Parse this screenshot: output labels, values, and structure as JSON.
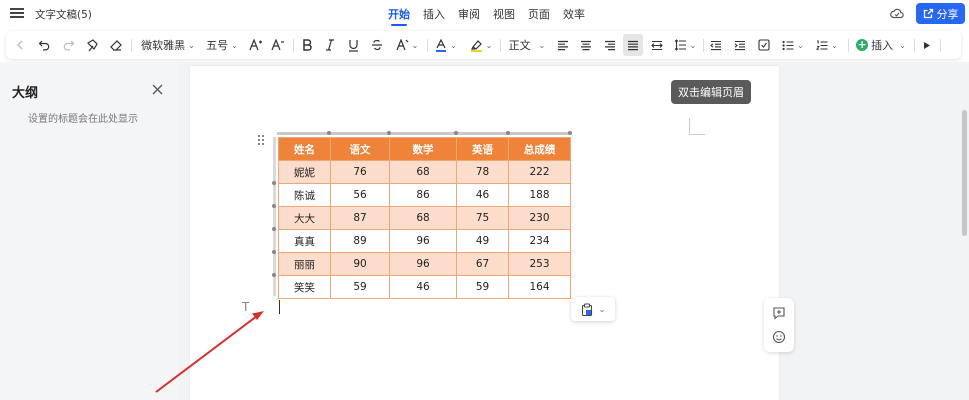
{
  "app": {
    "doc_title": "文字文稿(5)",
    "menu_tabs": [
      "开始",
      "插入",
      "审阅",
      "视图",
      "页面",
      "效率"
    ],
    "active_tab": "开始",
    "share_label": "分享",
    "accent_color": "#2866f6"
  },
  "toolbar": {
    "font_name": "微软雅黑",
    "font_size": "五号",
    "style_name": "正文",
    "insert_label": "插入",
    "icons": [
      "back-icon",
      "undo-icon",
      "redo-icon",
      "format-painter-icon",
      "eraser-icon",
      "font-increase-icon",
      "font-decrease-icon",
      "bold-icon",
      "italic-icon",
      "underline-icon",
      "strikethrough-icon",
      "text-effect-icon",
      "font-color-icon",
      "highlight-icon",
      "align-left-icon",
      "align-center-icon",
      "align-right-icon",
      "justify-icon",
      "distributed-icon",
      "line-spacing-icon",
      "indent-decrease-icon",
      "indent-increase-icon",
      "checkbox-icon",
      "bullet-list-icon",
      "numbered-list-icon",
      "plus-icon",
      "play-icon"
    ]
  },
  "outline": {
    "title": "大纲",
    "hint": "设置的标题会在此处显示"
  },
  "page": {
    "header_tip": "双击编辑页眉"
  },
  "table": {
    "headers": [
      "姓名",
      "语文",
      "数学",
      "英语",
      "总成绩"
    ],
    "rows": [
      [
        "妮妮",
        "76",
        "68",
        "78",
        "222"
      ],
      [
        "陈诚",
        "56",
        "86",
        "46",
        "188"
      ],
      [
        "大大",
        "87",
        "68",
        "75",
        "230"
      ],
      [
        "真真",
        "89",
        "96",
        "49",
        "234"
      ],
      [
        "丽丽",
        "90",
        "96",
        "67",
        "253"
      ],
      [
        "笑笑",
        "59",
        "46",
        "59",
        "164"
      ]
    ],
    "header_color": "#ee8339",
    "stripe_color": "#fcdccb"
  },
  "marks": {
    "paragraph_mark": "T"
  }
}
